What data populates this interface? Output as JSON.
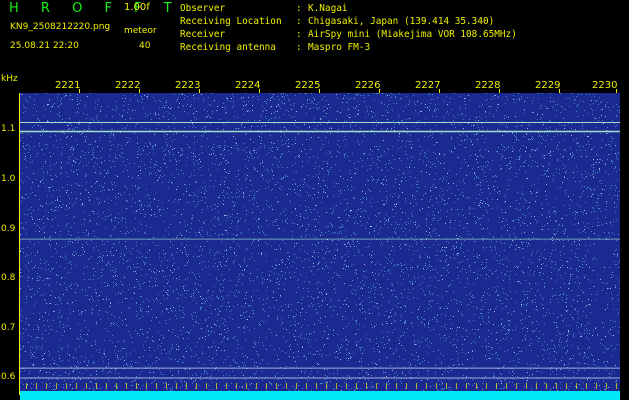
{
  "header": {
    "app_title": "H R O F F T",
    "version": "1.00f",
    "file_name": "KN9_2508212220.png",
    "mode": "meteor",
    "datetime": "25.08.21 22:20",
    "threshold": "40"
  },
  "station_info": [
    {
      "label": "Observer",
      "value": "K.Nagai"
    },
    {
      "label": "Receiving Location",
      "value": "Chigasaki, Japan (139.414 35.340)"
    },
    {
      "label": "Receiver",
      "value": "AirSpy mini (Miakejima VOR 108.65MHz)"
    },
    {
      "label": "Receiving antenna",
      "value": "Maspro FM-3"
    }
  ],
  "separator": ":",
  "frequency_axis": {
    "unit": "kHz",
    "ticks": [
      "1.1",
      "1.0",
      "0.9",
      "0.8",
      "0.7",
      "0.6"
    ]
  },
  "time_axis": {
    "ticks": [
      "2221",
      "2222",
      "2223",
      "2224",
      "2225",
      "2226",
      "2227",
      "2228",
      "2229",
      "2230"
    ]
  },
  "colors": {
    "background": "#000000",
    "label_text": "#f0f000",
    "title_text": "#17f017",
    "spectrum_base": "#1a2a90",
    "noise_speck": "#66ccff",
    "signal_line": "#b8ffd0",
    "bottom_band": "#00e8f8"
  },
  "spectrogram": {
    "signal_lines_khz": [
      1.115,
      1.097,
      0.88
    ],
    "reference_lines_khz": [
      0.62,
      0.6
    ]
  }
}
